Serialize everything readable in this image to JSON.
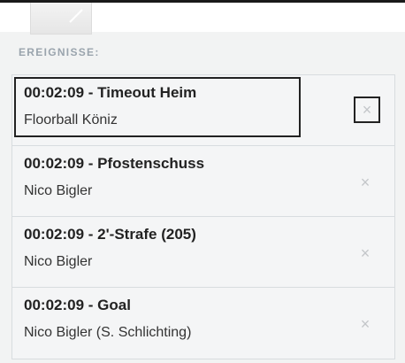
{
  "section": {
    "label": "EREIGNISSE:"
  },
  "events": [
    {
      "title": "00:02:09 - Timeout Heim",
      "subtitle": "Floorball Köniz",
      "remove": "×"
    },
    {
      "title": "00:02:09 - Pfostenschuss",
      "subtitle": "Nico Bigler",
      "remove": "×"
    },
    {
      "title": "00:02:09 - 2'-Strafe (205)",
      "subtitle": "Nico Bigler",
      "remove": "×"
    },
    {
      "title": "00:02:09 - Goal",
      "subtitle": "Nico Bigler (S. Schlichting)",
      "remove": "×"
    }
  ],
  "icons": {
    "corner": "edit-icon",
    "remove": "close-icon"
  },
  "colors": {
    "background": "#f2f3f3",
    "label": "#9aa4ad",
    "remove_icon": "#c3c6c9"
  }
}
